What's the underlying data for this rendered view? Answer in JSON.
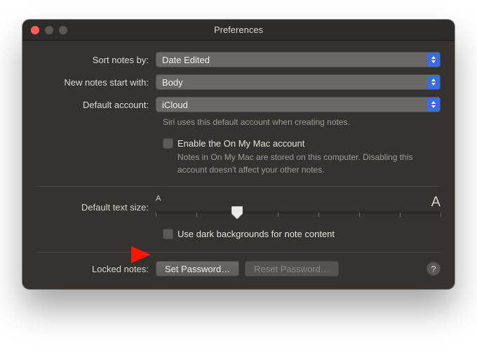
{
  "window": {
    "title": "Preferences"
  },
  "sort": {
    "label": "Sort notes by:",
    "value": "Date Edited"
  },
  "newNotes": {
    "label": "New notes start with:",
    "value": "Body"
  },
  "defaultAccount": {
    "label": "Default account:",
    "value": "iCloud",
    "hint": "Siri uses this default account when creating notes."
  },
  "enableOnMyMac": {
    "label": "Enable the On My Mac account",
    "hint": "Notes in On My Mac are stored on this computer. Disabling this account doesn't affect your other notes."
  },
  "textSize": {
    "label": "Default text size:",
    "smallGlyph": "A",
    "largeGlyph": "A"
  },
  "darkBackgrounds": {
    "label": "Use dark backgrounds for note content"
  },
  "locked": {
    "label": "Locked notes:",
    "setPassword": "Set Password…",
    "resetPassword": "Reset Password…"
  },
  "help": {
    "glyph": "?"
  }
}
